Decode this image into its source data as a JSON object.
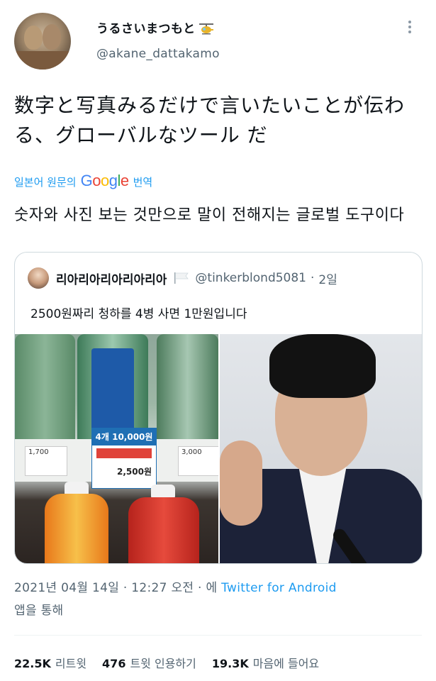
{
  "author": {
    "display_name": "うるさいまつもと",
    "handle": "@akane_dattakamo"
  },
  "tweet": {
    "text": "数字と写真みるだけで言いたいことが伝わる、グローバルなツール だ",
    "translate_prefix": "일본어 원문의",
    "translate_brand": "Google",
    "translate_suffix": "번역",
    "translated_text": "숫자와 사진 보는 것만으로 말이 전해지는 글로벌 도구이다"
  },
  "quoted": {
    "display_name": "리아리아리아리아리아",
    "handle": "@tinkerblond5081",
    "separator": "·",
    "age": "2일",
    "text": "2500원짜리 청하를 4병 사면 1만원입니다",
    "price_tag_top": "4개 10,000원",
    "price_tag_main": "2,500원",
    "tag_left": "1,700",
    "tag_right": "3,000"
  },
  "meta": {
    "timestamp": "2021년 04월 14일 · 12:27 오전 · 에",
    "source": "Twitter for Android",
    "source_suffix": "앱을 통해"
  },
  "stats": {
    "retweets_count": "22.5K",
    "retweets_label": "리트윗",
    "quotes_count": "476",
    "quotes_label": "트윗 인용하기",
    "likes_count": "19.3K",
    "likes_label": "마음에 들어요"
  },
  "colors": {
    "link": "#1d9bf0",
    "secondary_text": "#536471",
    "primary_text": "#0f1419"
  },
  "icons": {
    "more": "more-vertical-icon",
    "name_badge": "helicopter-icon",
    "flag": "flag-icon"
  }
}
